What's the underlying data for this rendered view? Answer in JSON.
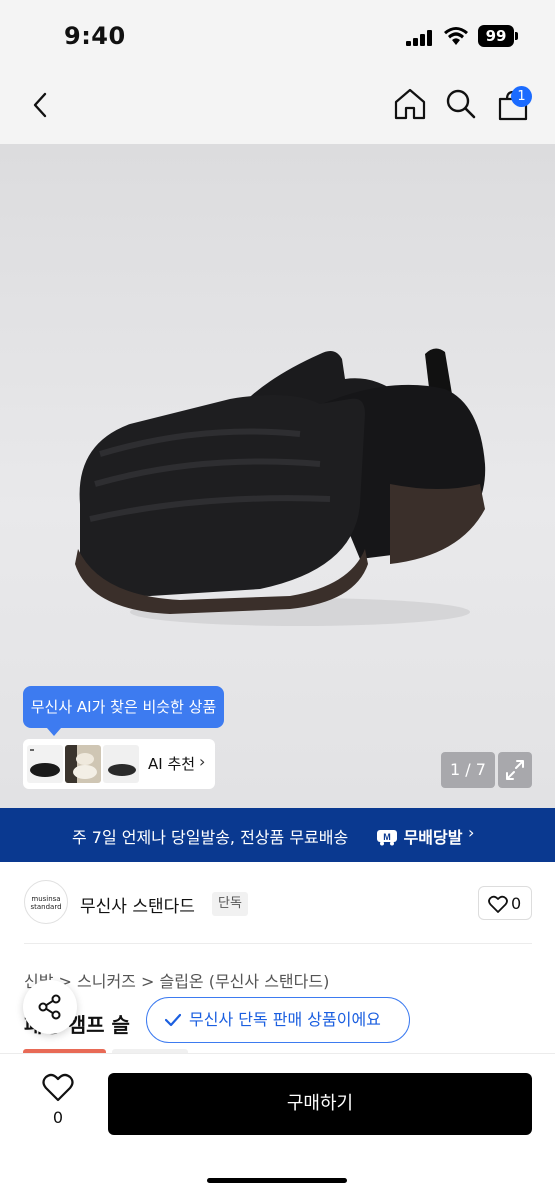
{
  "status_bar": {
    "time": "9:40",
    "battery": "99"
  },
  "nav": {
    "cart_count": "1",
    "icons": [
      "back-arrow-icon",
      "home-icon",
      "search-icon",
      "cart-icon"
    ]
  },
  "hero": {
    "ai_tooltip": "무신사 AI가 찾은 비슷한 상품",
    "ai_card_label": "AI 추천",
    "page_counter": "1 / 7"
  },
  "delivery": {
    "text": "주 7일 언제나 당일발송, 전상품 무료배송",
    "logo": "무배당발"
  },
  "brand": {
    "logo_text": "musinsa standard",
    "name": "무신사 스탠다드",
    "tag": "단독",
    "like_count": "0"
  },
  "product": {
    "breadcrumb": "신발 > 스니커즈 > 슬립온 (무신사 스탠다드)",
    "title": "패딩 캠프 슬",
    "exclusive_text": "무신사 단독 판매 상품이에요"
  },
  "bottom_bar": {
    "wish_count": "0",
    "buy_label": "구매하기"
  },
  "colors": {
    "accent_blue": "#3d7bf0",
    "banner_navy": "#0a3990",
    "cart_badge": "#1b6bff",
    "sale_red": "#e86a56"
  }
}
